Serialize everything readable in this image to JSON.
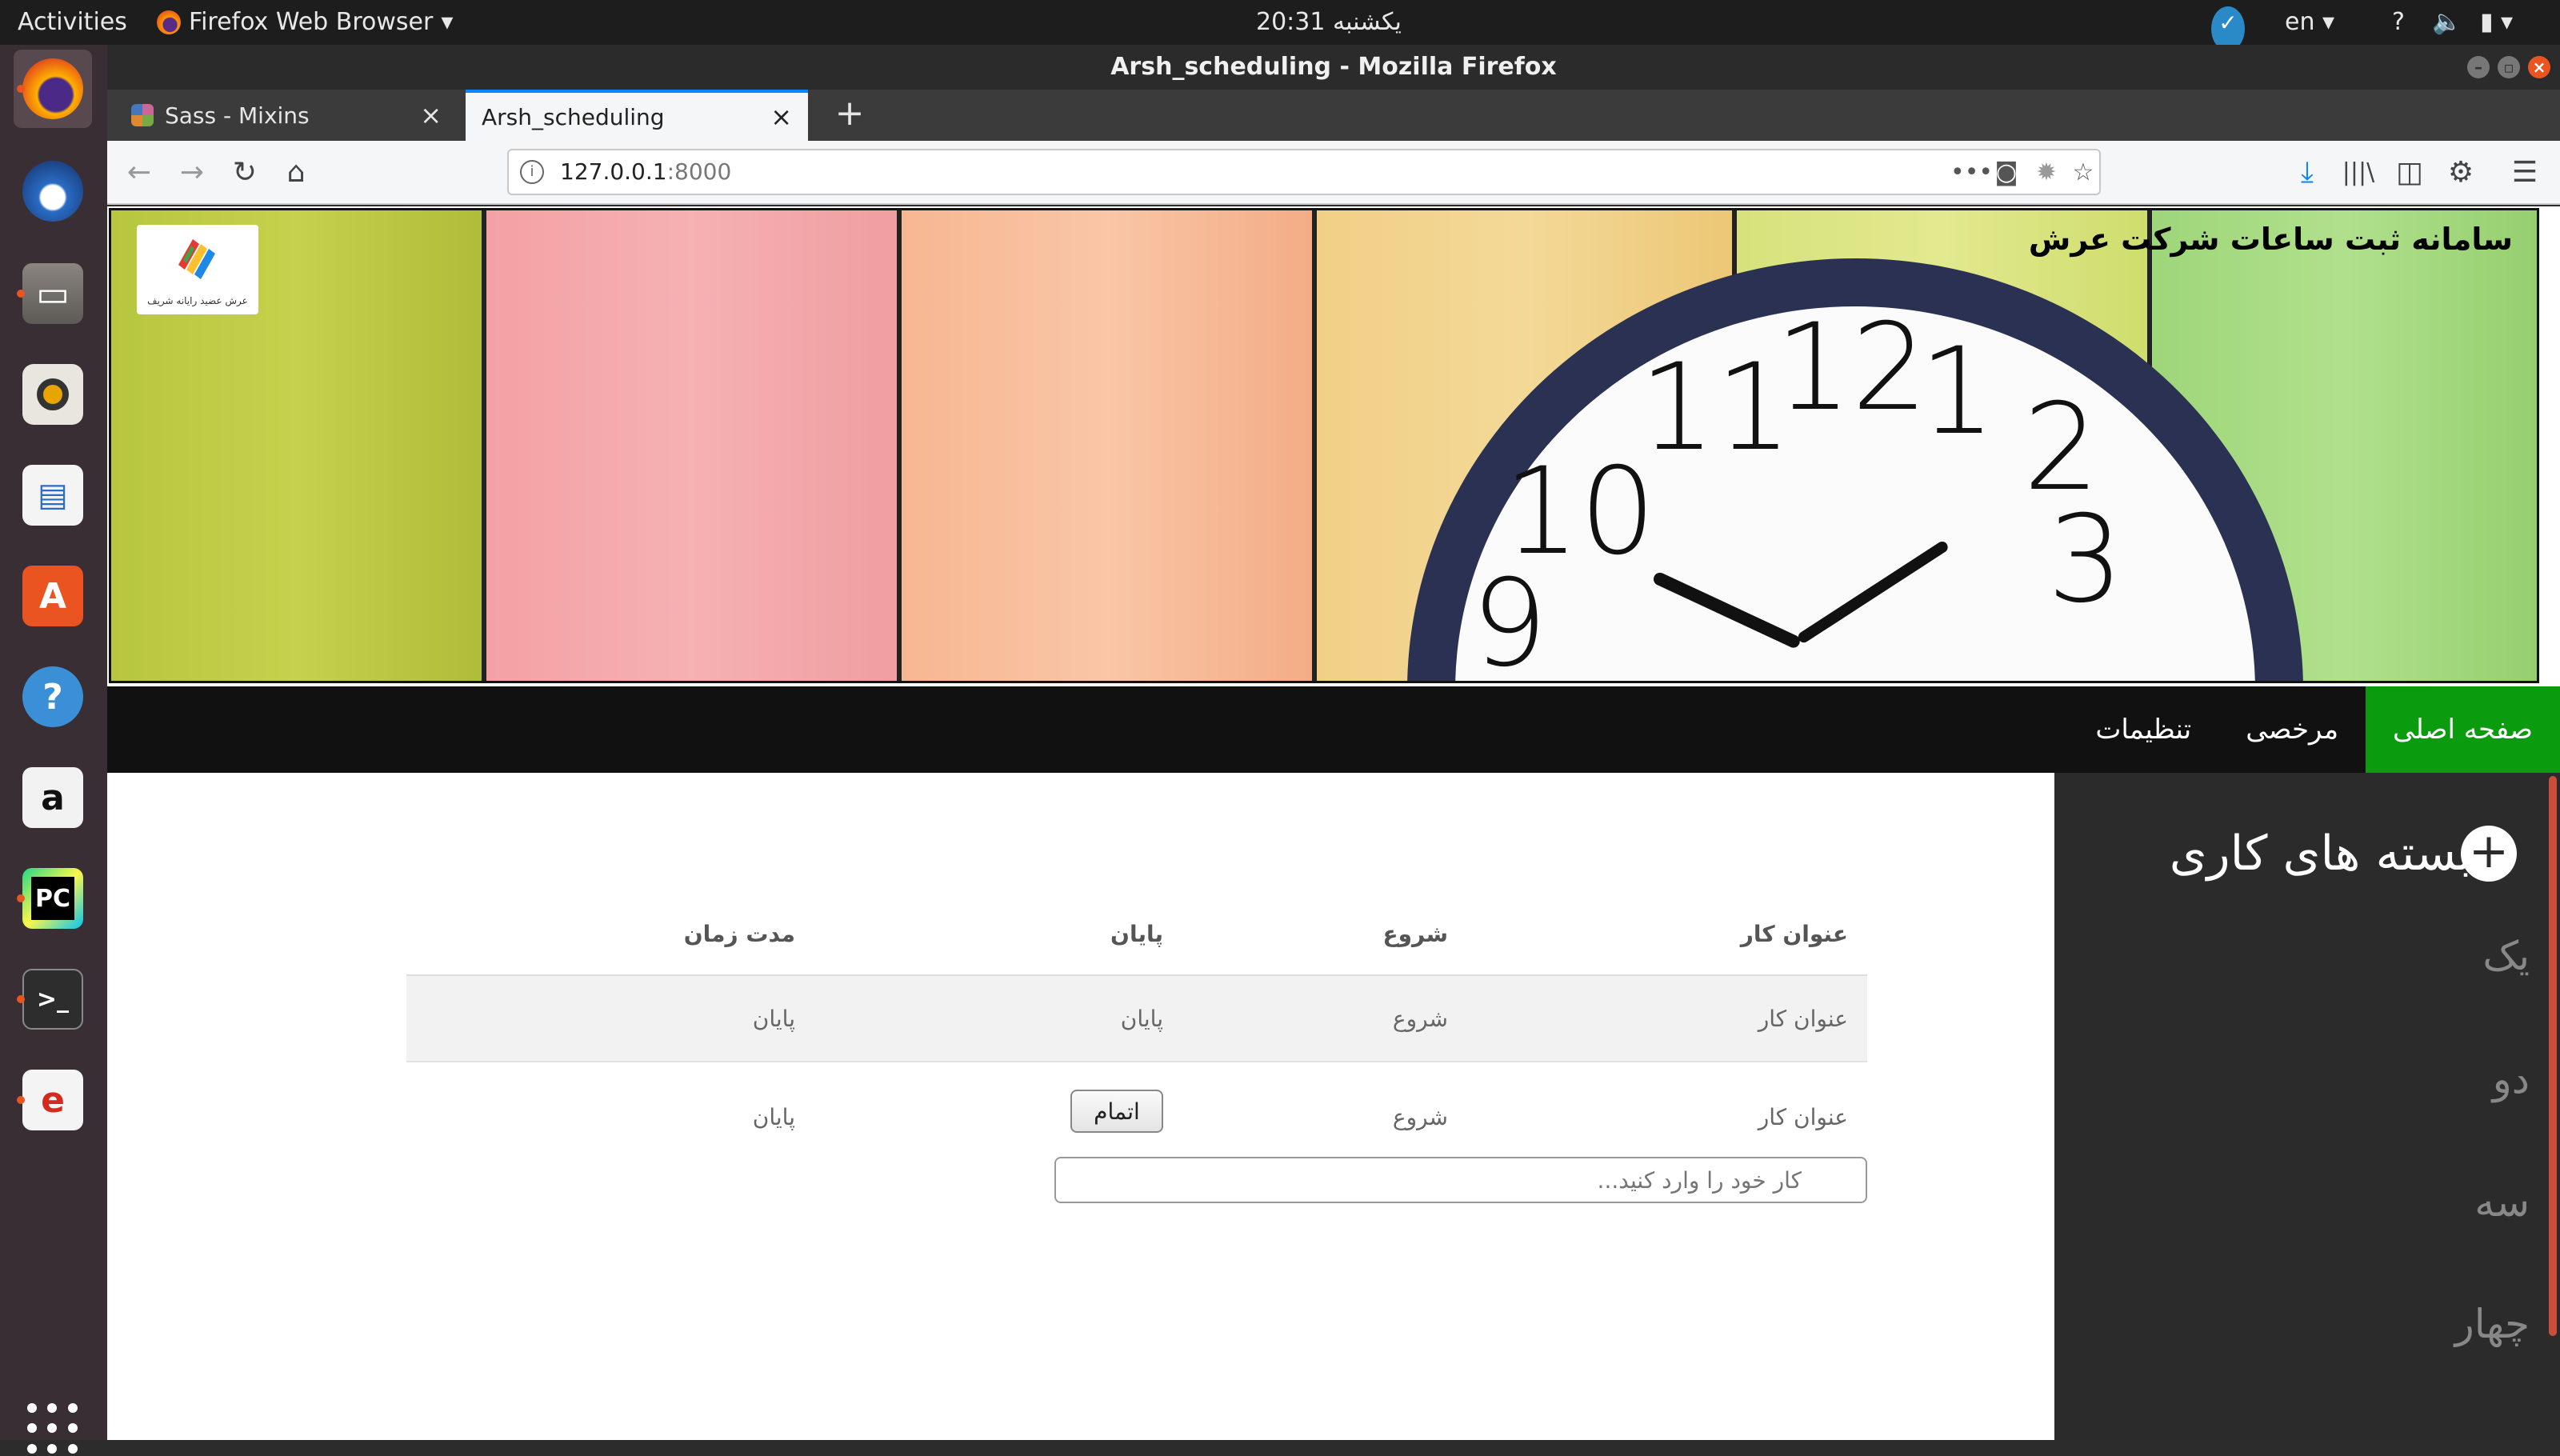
{
  "topbar": {
    "activities": "Activities",
    "app_name": "Firefox Web Browser",
    "clock": "یکشنبه 20:31",
    "lang": "en",
    "help": "?",
    "icons": [
      "shield-check-icon",
      "volume-icon",
      "battery-icon",
      "chevron-down-icon"
    ]
  },
  "window": {
    "title": "Arsh_scheduling - Mozilla Firefox",
    "tabs": [
      {
        "label": "Sass - Mixins",
        "active": false
      },
      {
        "label": "Arsh_scheduling",
        "active": true
      }
    ],
    "url_host": "127.0.0.1",
    "url_port": ":8000"
  },
  "dock": [
    "firefox",
    "thunderbird",
    "files",
    "rhythmbox",
    "libreoffice-writer",
    "ubuntu-software",
    "help",
    "amazon",
    "pycharm",
    "terminal",
    "eog"
  ],
  "site": {
    "brand_title": "سامانه ثبت ساعات شرکت عرش",
    "logo_text": "عرش  عضید رایانه شریف",
    "nav": [
      "صفحه اصلی",
      "مرخصی",
      "تنظیمات"
    ]
  },
  "table": {
    "headers": [
      "عنوان کار",
      "شروع",
      "پایان",
      "مدت زمان"
    ],
    "rows": [
      [
        "عنوان کار",
        "شروع",
        "پایان",
        "پایان"
      ],
      [
        "عنوان کار",
        "شروع",
        "",
        "پایان"
      ]
    ],
    "finish_label": "اتمام",
    "input_placeholder": "کار خود را وارد کنید..."
  },
  "sidebar": {
    "title": "بسته های کاری",
    "add": "+",
    "items": [
      "یک",
      "دو",
      "سه",
      "چهار"
    ]
  },
  "colors": {
    "nav_active": "#0a9b0e",
    "nav_bg": "#111111",
    "sidebar_bg": "#2b2b2b",
    "accent_tab": "#0a84ff"
  }
}
